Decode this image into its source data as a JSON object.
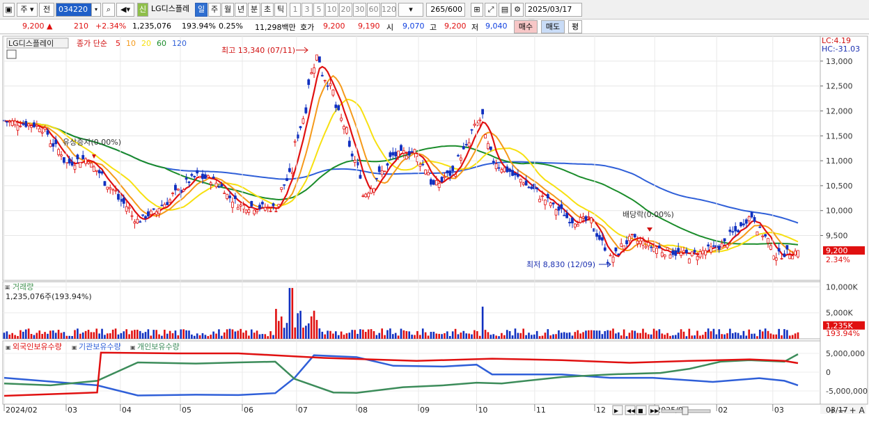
{
  "toolbar": {
    "period_type": "주",
    "mode": "전",
    "code": "034220",
    "name": "LG디스플레",
    "tag_new": "신",
    "periods": [
      "일",
      "주",
      "월",
      "년",
      "분",
      "초",
      "틱"
    ],
    "active_period": "일",
    "minutes": [
      "1",
      "3",
      "5",
      "10",
      "20",
      "30",
      "60",
      "120"
    ],
    "count": "265",
    "count_total": "/600",
    "date": "2025/03/17"
  },
  "quote": {
    "price": "9,200",
    "arrow": "▲",
    "change": "210",
    "change_pct": "+2.34%",
    "volume": "1,235,076",
    "vol_pct": "193.94%",
    "turnover": "0.25%",
    "amount": "11,298백만",
    "hoga_label": "호가",
    "ask": "9,200",
    "bid": "9,190",
    "open_label": "시",
    "open": "9,070",
    "high_label": "고",
    "high": "9,200",
    "low_label": "저",
    "low": "9,040",
    "buy": "매수",
    "sell": "매도",
    "avg": "평"
  },
  "legend": {
    "name": "LG디스플레이",
    "label": "종가 단순",
    "ma": [
      "5",
      "10",
      "20",
      "60",
      "120"
    ]
  },
  "colors": {
    "up": "#e01010",
    "down": "#1030c0",
    "ma5": "#e01010",
    "ma10": "#f59a1a",
    "ma20": "#f7e010",
    "ma60": "#1a8c2a",
    "ma120": "#2f5fd8",
    "foreign": "#e01010",
    "inst": "#2f5fd8",
    "indiv": "#3c8c5a"
  },
  "annotations": {
    "high": "최고 13,340 (07/11)",
    "low": "최저 8,830 (12/09)",
    "rights": "유상증자(0.00%)",
    "dividend": "배당락(0.00%)",
    "lc": "LC:4.19",
    "hc": "HC:-31.03",
    "cur_price": "9,200",
    "cur_pct": "2.34%",
    "vol_title": "거래량",
    "vol_info": "1,235,076주(193.94%)",
    "vol_cur": "1,235K",
    "vol_pct": "193.94%"
  },
  "indicator": {
    "labels": [
      "외국인보유수량",
      "기관보유수량",
      "개인보유수량"
    ]
  },
  "chart_data": [
    {
      "type": "candlestick+line",
      "title": "LG디스플레이",
      "ylim": [
        8600,
        13500
      ],
      "yticks": [
        9500,
        10000,
        10500,
        11000,
        11500,
        12000,
        12500,
        13000
      ],
      "ytick_labels": [
        "9,500",
        "10,000",
        "10,500",
        "11,000",
        "11,500",
        "12,000",
        "12,500",
        "13,000"
      ],
      "x_labels": [
        "2024/02",
        "03",
        "04",
        "05",
        "06",
        "07",
        "08",
        "09",
        "10",
        "11",
        "12",
        "2025/01",
        "02",
        "03"
      ],
      "series": [
        {
          "name": "5",
          "values": "approx. moving averages of close"
        }
      ],
      "close_path_key": [
        [
          "2024-02-01",
          11800
        ],
        [
          "2024-02-20",
          11700
        ],
        [
          "2024-03-05",
          10950
        ],
        [
          "2024-03-15",
          11050
        ],
        [
          "2024-04-10",
          9800
        ],
        [
          "2024-04-20",
          10000
        ],
        [
          "2024-05-10",
          10700
        ],
        [
          "2024-05-20",
          10600
        ],
        [
          "2024-06-01",
          10100
        ],
        [
          "2024-06-20",
          10050
        ],
        [
          "2024-06-28",
          10800
        ],
        [
          "2024-07-11",
          13100
        ],
        [
          "2024-07-20",
          12300
        ],
        [
          "2024-07-31",
          11000
        ],
        [
          "2024-08-05",
          10300
        ],
        [
          "2024-08-20",
          11100
        ],
        [
          "2024-08-31",
          11200
        ],
        [
          "2024-09-10",
          10500
        ],
        [
          "2024-09-20",
          10800
        ],
        [
          "2024-10-04",
          11900
        ],
        [
          "2024-10-10",
          11000
        ],
        [
          "2024-10-25",
          10600
        ],
        [
          "2024-11-10",
          10100
        ],
        [
          "2024-11-20",
          9800
        ],
        [
          "2024-11-30",
          9800
        ],
        [
          "2024-12-09",
          9000
        ],
        [
          "2024-12-20",
          9450
        ],
        [
          "2025-01-05",
          9200
        ],
        [
          "2025-01-20",
          9100
        ],
        [
          "2025-02-05",
          9300
        ],
        [
          "2025-02-20",
          9900
        ],
        [
          "2025-03-05",
          9100
        ],
        [
          "2025-03-17",
          9200
        ]
      ]
    },
    {
      "type": "bar",
      "title": "거래량",
      "ylim": [
        0,
        11000000
      ],
      "yticks_labels": [
        "10,000K",
        "5,000K"
      ],
      "last": 1235076
    },
    {
      "type": "line",
      "title": "보유수량",
      "series": [
        "외국인보유수량",
        "기관보유수량",
        "개인보유수량"
      ],
      "ytick_labels": [
        "5,000,000",
        "0",
        "-5,000,000"
      ]
    }
  ]
}
